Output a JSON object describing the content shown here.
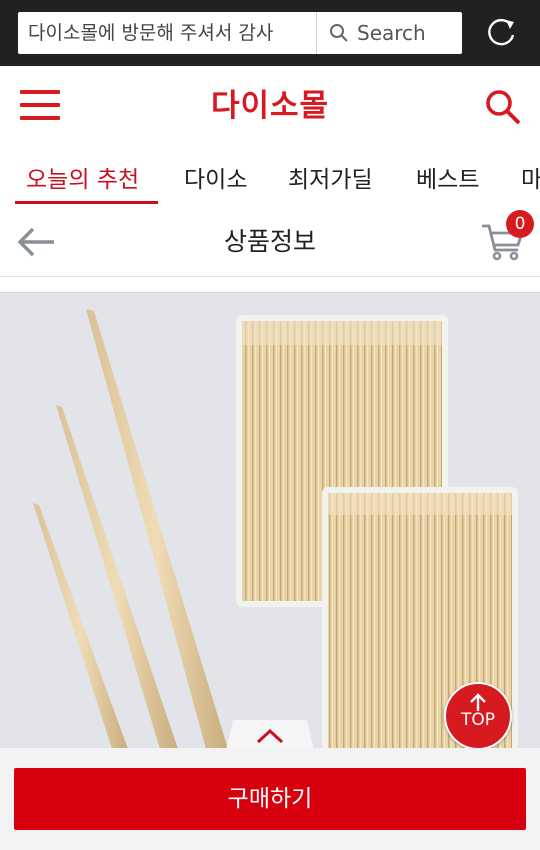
{
  "browser": {
    "url_text": "다이소몰에 방문해 주셔서 감사",
    "search_label": "Search"
  },
  "header": {
    "logo": "다이소몰"
  },
  "tabs": [
    {
      "label": "오늘의 추천",
      "active": true
    },
    {
      "label": "다이소",
      "active": false
    },
    {
      "label": "최저가딜",
      "active": false
    },
    {
      "label": "베스트",
      "active": false
    },
    {
      "label": "마",
      "active": false
    }
  ],
  "subheader": {
    "title": "상품정보",
    "cart_count": "0"
  },
  "floating": {
    "top_label": "TOP"
  },
  "actions": {
    "buy_label": "구매하기"
  },
  "colors": {
    "brand_red": "#d71920",
    "tab_active": "#c8101e"
  }
}
